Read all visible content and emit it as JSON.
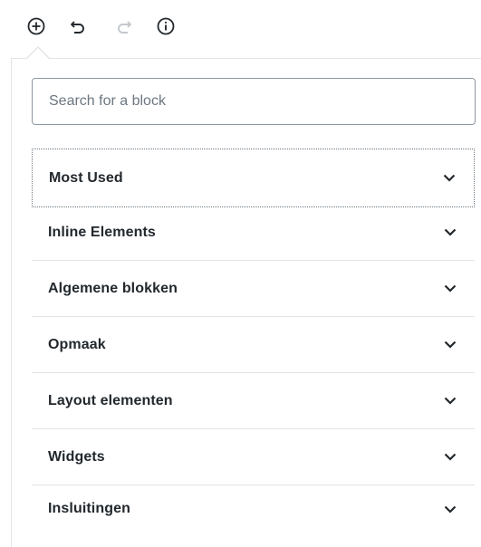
{
  "toolbar": {
    "add_block": "add-block",
    "undo": "undo",
    "redo": "redo",
    "info": "info"
  },
  "inserter": {
    "search": {
      "placeholder": "Search for a block",
      "value": ""
    },
    "panels": [
      {
        "label": "Most Used",
        "expanded": false,
        "focused": true
      },
      {
        "label": "Inline Elements",
        "expanded": false
      },
      {
        "label": "Algemene blokken",
        "expanded": false
      },
      {
        "label": "Opmaak",
        "expanded": false
      },
      {
        "label": "Layout elementen",
        "expanded": false
      },
      {
        "label": "Widgets",
        "expanded": false
      },
      {
        "label": "Insluitingen",
        "expanded": false
      }
    ]
  },
  "colors": {
    "icon": "#23282d",
    "icon_disabled": "#c3c7cb",
    "border": "#e2e4e7",
    "text": "#23282d"
  }
}
